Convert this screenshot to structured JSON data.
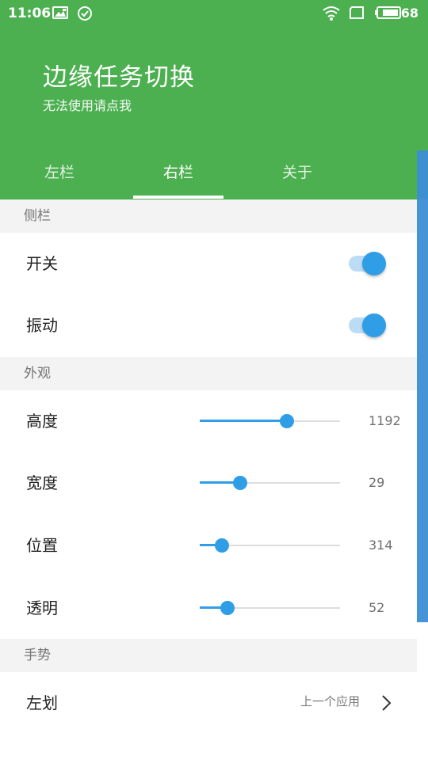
{
  "status_bar": {
    "time": "11:06",
    "battery": "68",
    "icons": [
      "image-icon",
      "check-circle-icon",
      "wifi-icon",
      "screen-icon",
      "battery-icon"
    ]
  },
  "header": {
    "title": "边缘任务切换",
    "subtitle": "无法使用请点我",
    "color": "#4caf50"
  },
  "tabs": [
    {
      "label": "左栏",
      "active": false
    },
    {
      "label": "右栏",
      "active": true
    },
    {
      "label": "关于",
      "active": false
    }
  ],
  "sections": {
    "sidebar": {
      "title": "侧栏",
      "items": [
        {
          "label": "开关",
          "on": true
        },
        {
          "label": "振动",
          "on": true
        }
      ]
    },
    "appearance": {
      "title": "外观",
      "items": [
        {
          "label": "高度",
          "value": "1192",
          "fraction": 0.62
        },
        {
          "label": "宽度",
          "value": "29",
          "fraction": 0.29
        },
        {
          "label": "位置",
          "value": "314",
          "fraction": 0.16
        },
        {
          "label": "透明",
          "value": "52",
          "fraction": 0.2
        }
      ]
    },
    "gesture": {
      "title": "手势",
      "items": [
        {
          "label": "左划",
          "value": "上一个应用"
        }
      ]
    }
  },
  "accent_color": "#2f9ee6"
}
